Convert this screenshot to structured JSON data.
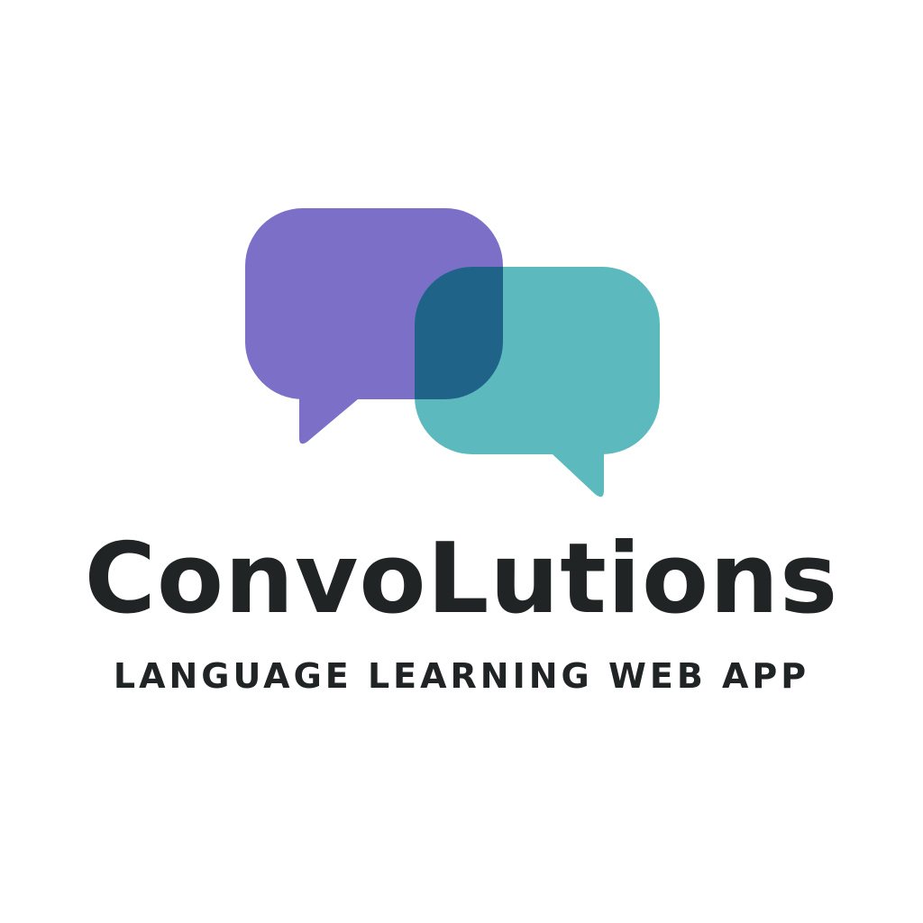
{
  "brand": {
    "name": "ConvoLutions",
    "tagline": "LANGUAGE LEARNING WEB APP"
  },
  "logo": {
    "icon": "overlapping-speech-bubbles-icon",
    "colors": {
      "left_bubble": "#7B6FC8",
      "right_bubble": "#5CB9BD",
      "overlap": "#1F6389",
      "text": "#212425",
      "background": "#FFFFFF"
    }
  }
}
